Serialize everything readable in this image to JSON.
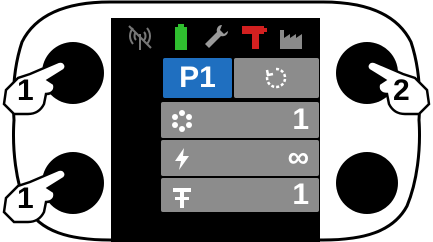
{
  "device": {
    "status_icons": [
      "wireless-off-icon",
      "battery-icon",
      "wrench-icon",
      "drill-icon",
      "factory-icon"
    ],
    "program_label": "P1",
    "rows": [
      {
        "icon": "gear-pattern-icon",
        "value": "1"
      },
      {
        "icon": "lightning-icon",
        "value": "∞"
      },
      {
        "icon": "fastener-icon",
        "value": "1"
      }
    ],
    "side_symbols": {
      "plus": "+",
      "minus": "−",
      "back": "↩",
      "check": "✓"
    },
    "button_labels": {
      "left_top": "1",
      "left_bottom": "1",
      "right_top": "2"
    }
  },
  "colors": {
    "program_bg": "#1f6fc0",
    "row_bg": "#8c8c8c",
    "battery": "#2fbf2f",
    "drill": "#d22020"
  }
}
